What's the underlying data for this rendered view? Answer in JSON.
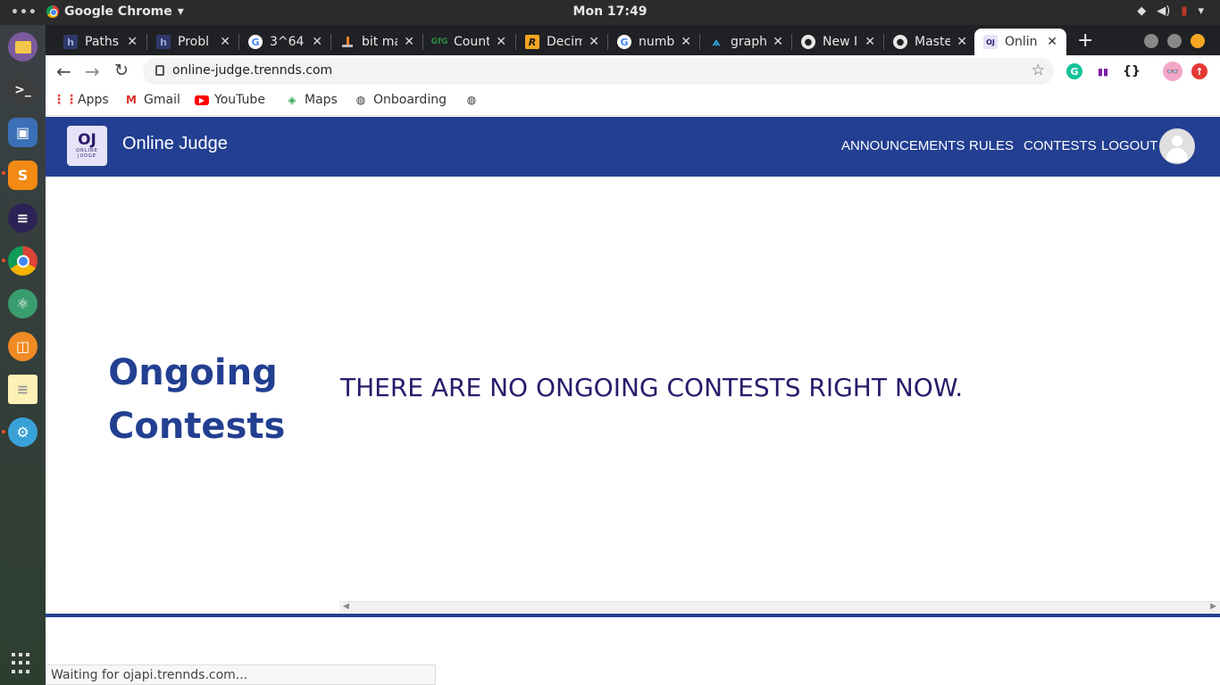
{
  "system_bar": {
    "app_name": "Google Chrome",
    "app_menu_arrow": "▾",
    "clock": "Mon 17:49"
  },
  "tabs": [
    {
      "title": "Paths",
      "favicon": "h"
    },
    {
      "title": "Probl",
      "favicon": "h"
    },
    {
      "title": "3^64 -",
      "favicon": "G"
    },
    {
      "title": "bit ma",
      "favicon": "so"
    },
    {
      "title": "Count",
      "favicon": "GfG"
    },
    {
      "title": "Decim",
      "favicon": "R"
    },
    {
      "title": "numb",
      "favicon": "G"
    },
    {
      "title": "graph",
      "favicon": "graph"
    },
    {
      "title": "New I",
      "favicon": "github"
    },
    {
      "title": "Maste",
      "favicon": "github"
    },
    {
      "title": "Onlin",
      "favicon": "OJ"
    }
  ],
  "address_bar": {
    "url": "online-judge.trennds.com"
  },
  "bookmarks": [
    {
      "label": "Apps"
    },
    {
      "label": "Gmail"
    },
    {
      "label": "YouTube"
    },
    {
      "label": "Maps"
    },
    {
      "label": "Onboarding"
    }
  ],
  "site": {
    "logo_text": "OJ",
    "logo_sub1": "ONLINE",
    "logo_sub2": "JUDGE",
    "brand": "Online Judge",
    "nav": {
      "announcements": "ANNOUNCEMENTS",
      "rules": "RULES",
      "contests": "CONTESTS",
      "logout": "LOGOUT"
    },
    "colors": {
      "header": "#233f91",
      "title": "#233f91",
      "message": "#2b1a6b"
    }
  },
  "main": {
    "title_line1": "Ongoing",
    "title_line2": "Contests",
    "empty_message": "THERE ARE NO ONGOING CONTESTS RIGHT NOW."
  },
  "status_bar": {
    "text": "Waiting for ojapi.trennds.com..."
  }
}
